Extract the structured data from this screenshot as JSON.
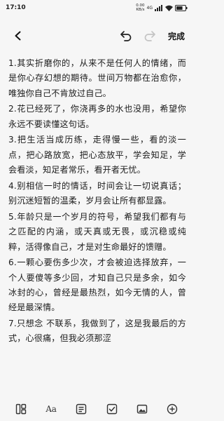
{
  "status_bar": {
    "time": "17:10",
    "net_speed_value": "0.00",
    "net_speed_unit": "KB/s",
    "network_type": "4G",
    "battery_level": 72
  },
  "toolbar": {
    "done_label": "完成",
    "redo_enabled": false
  },
  "content": {
    "paragraphs": [
      " 1.其实折磨你的，从来不是任何人的情绪，而是你心存幻想的期待。世间万物都在治愈你，唯独你自己不肯放过自己。",
      "2.花已经死了，你浇再多的水也没用，希望你永远不要读懂这句话。",
      "3.把生活当成历练，走得慢一些，看的淡一点，把心路放宽，把心态放平，学会知足，学会看淡，知足者常乐，看开者无忧。",
      "4.别相信一时的情话，时间会让一切说真话；别沉迷短暂的温柔，岁月会让所有都显露。",
      "5.年龄只是一个岁月的符号，希望我们都有与之匹配的内涵，或天真或无畏，或沉稳或纯粹，活得像自己，才是对生命最好的馈赠。",
      "6.一颗心要伤多少次，才会被迫选择放弃，一个人要傻等多少回，才知自己只是多余，如今冰封的心，曾经是最热烈，如今无情的人，曾经是最深情。",
      "7.只想念 不联系，我做到了，这是我最后的方式，心很痛，但我必须那涩"
    ]
  },
  "bottom_bar": {
    "font_label": "Aa"
  },
  "colors": {
    "background": "#f6f6f6",
    "text": "#1c1c1c",
    "icon": "#333333",
    "disabled_icon": "#c4c4c4"
  }
}
